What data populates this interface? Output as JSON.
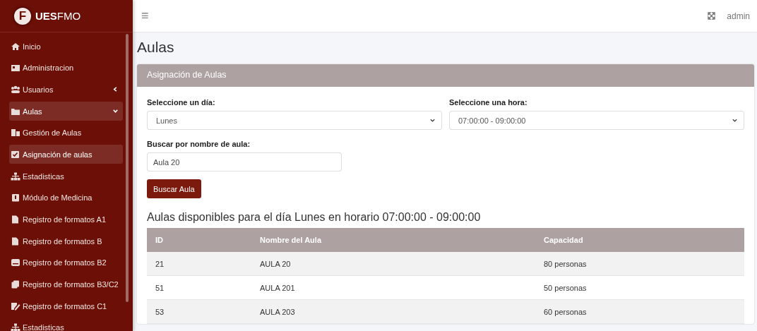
{
  "brand": {
    "name": "**UES**FMO",
    "logo_letter": "F"
  },
  "topbar": {
    "menu_glyph": "≡",
    "user": "admin"
  },
  "sidebar": {
    "items": [
      {
        "label": "Inicio",
        "selected": false
      },
      {
        "label": "Administracion",
        "selected": false
      },
      {
        "label": "Usuarios",
        "selected": false,
        "expanded": false
      },
      {
        "label": "Aulas",
        "selected": true,
        "expanded": true,
        "children": [
          {
            "label": "Gestión de Aulas",
            "selected": false
          },
          {
            "label": "Asignación de aulas",
            "selected": true
          },
          {
            "label": "Estadisticas",
            "selected": false
          }
        ]
      },
      {
        "label": "Módulo de Medicina",
        "selected": false
      },
      {
        "label": "Registro de formatos A1",
        "selected": false
      },
      {
        "label": "Registro de formatos B",
        "selected": false
      },
      {
        "label": "Registro de formatos B2",
        "selected": false
      },
      {
        "label": "Registro de formatos B3/C2",
        "selected": false
      },
      {
        "label": "Registro de formatos C1",
        "selected": false
      },
      {
        "label": "Estadisticas",
        "selected": false
      }
    ]
  },
  "page": {
    "title": "Aulas"
  },
  "card": {
    "title": "Asignación de Aulas",
    "day": {
      "label": "Seleccione un día:",
      "value": "Lunes"
    },
    "hour": {
      "label": "Seleccione una hora:",
      "value": "07:00:00 - 09:00:00"
    },
    "search": {
      "label": "Buscar por nombre de aula:",
      "value": "Aula 20"
    },
    "button": "Buscar Aula",
    "results_title": "Aulas disponibles para el día Lunes en horario 07:00:00 - 09:00:00",
    "table": {
      "columns": [
        "ID",
        "Nombre del Aula",
        "Capacidad"
      ],
      "rows": [
        [
          "21",
          "AULA 20",
          "80 personas"
        ],
        [
          "51",
          "AULA 201",
          "50 personas"
        ],
        [
          "53",
          "AULA 203",
          "60 personas"
        ]
      ]
    }
  }
}
